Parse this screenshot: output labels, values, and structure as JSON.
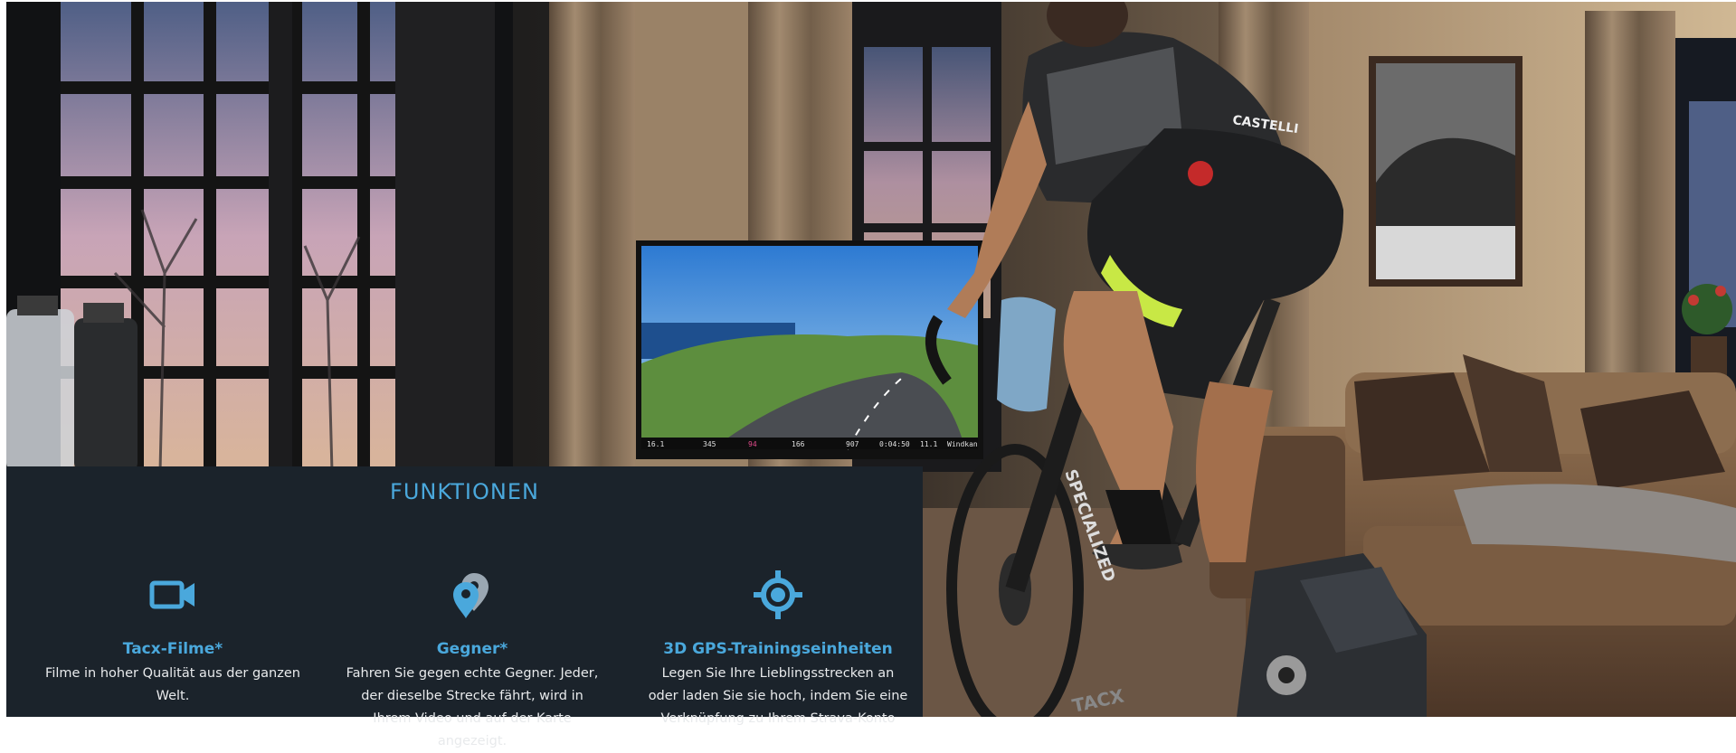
{
  "hero": {
    "screen_readout": {
      "distance": "16.1",
      "power": "345",
      "heart_rate": "94",
      "cadence": "166",
      "altitude": "907",
      "time": "0:04:50",
      "grade": "11.1",
      "wind": "Windkan"
    },
    "jersey_text": "CASTELLI",
    "bike_text": "SPECIALIZED",
    "trainer_text": "TACX"
  },
  "features": {
    "title": "FUNKTIONEN",
    "items": [
      {
        "icon": "video-camera-icon",
        "heading": "Tacx-Filme*",
        "description": "Filme in hoher Qualität aus der ganzen Welt."
      },
      {
        "icon": "map-pin-icon",
        "heading": "Gegner*",
        "description": "Fahren Sie gegen echte Gegner. Jeder, der dieselbe Strecke fährt, wird in Ihrem Video und auf der Karte angezeigt."
      },
      {
        "icon": "gps-target-icon",
        "heading": "3D GPS-Trainingseinheiten",
        "description": "Legen Sie Ihre Lieblingsstrecken an oder laden Sie sie hoch, indem Sie eine Verknüpfung zu Ihrem Strava-Konto"
      }
    ]
  },
  "colors": {
    "accent": "#4aa8dc",
    "panel_bg": "#1b232b",
    "body_text": "#e8eaec"
  }
}
